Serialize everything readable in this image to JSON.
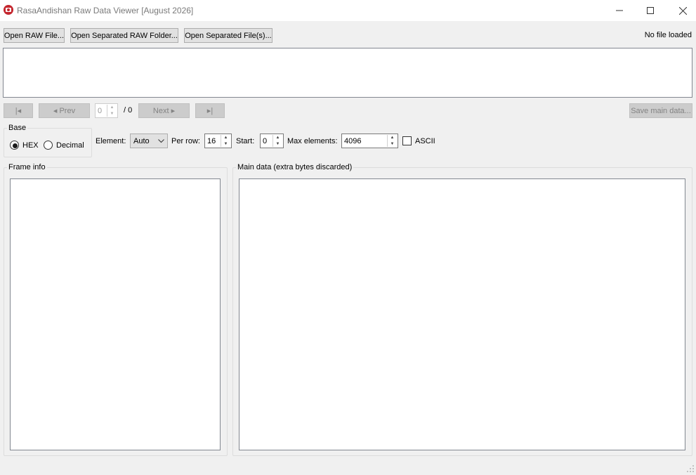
{
  "window": {
    "title": "RasaAndishan Raw Data Viewer [August 2026]",
    "minimize_icon": "minimize-icon",
    "maximize_icon": "maximize-icon",
    "close_icon": "close-icon",
    "app_icon": "camera-icon",
    "app_icon_color": "#c4262e"
  },
  "toolbar": {
    "open_raw_file": "Open RAW File...",
    "open_separated_folder": "Open Separated RAW Folder...",
    "open_separated_files": "Open Separated File(s)...",
    "status": "No file loaded"
  },
  "nav": {
    "first": "|◂",
    "prev": "◂ Prev",
    "frame_index": "0",
    "frame_total": "/ 0",
    "next": "Next ▸",
    "last": "▸|",
    "save_main_data": "Save main data..."
  },
  "base": {
    "title": "Base",
    "options": [
      "HEX",
      "Decimal"
    ],
    "selected": "HEX"
  },
  "options": {
    "element_label": "Element:",
    "element_value": "Auto",
    "per_row_label": "Per row:",
    "per_row_value": "16",
    "start_label": "Start:",
    "start_value": "0",
    "max_elements_label": "Max elements:",
    "max_elements_value": "4096",
    "ascii_label": "ASCII",
    "ascii_checked": false
  },
  "panels": {
    "frame_info_title": "Frame info",
    "main_data_title": "Main data (extra bytes discarded)"
  }
}
